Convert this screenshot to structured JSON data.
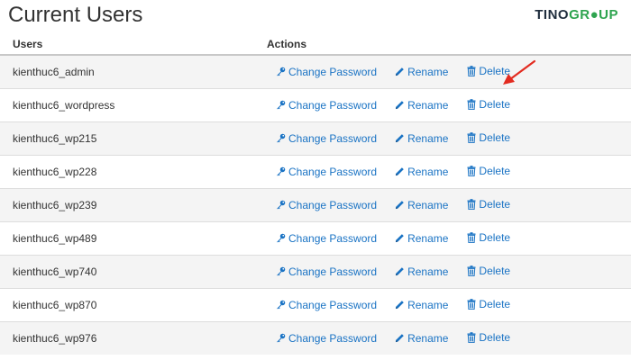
{
  "page": {
    "title": "Current Users"
  },
  "brand": {
    "part1": "TINO",
    "part2": "GR",
    "part3": "UP"
  },
  "table": {
    "headers": {
      "users": "Users",
      "actions": "Actions"
    },
    "actions": {
      "change_password": "Change Password",
      "rename": "Rename",
      "delete": "Delete"
    },
    "rows": [
      "kienthuc6_admin",
      "kienthuc6_wordpress",
      "kienthuc6_wp215",
      "kienthuc6_wp228",
      "kienthuc6_wp239",
      "kienthuc6_wp489",
      "kienthuc6_wp740",
      "kienthuc6_wp870",
      "kienthuc6_wp976"
    ]
  },
  "icons": {
    "change_password": "key-icon",
    "rename": "pencil-icon",
    "delete": "trash-icon"
  },
  "colors": {
    "link": "#1a73c4",
    "annotation": "#e32b20",
    "brand_dark": "#1f2d3d",
    "brand_green": "#2ea44f"
  }
}
